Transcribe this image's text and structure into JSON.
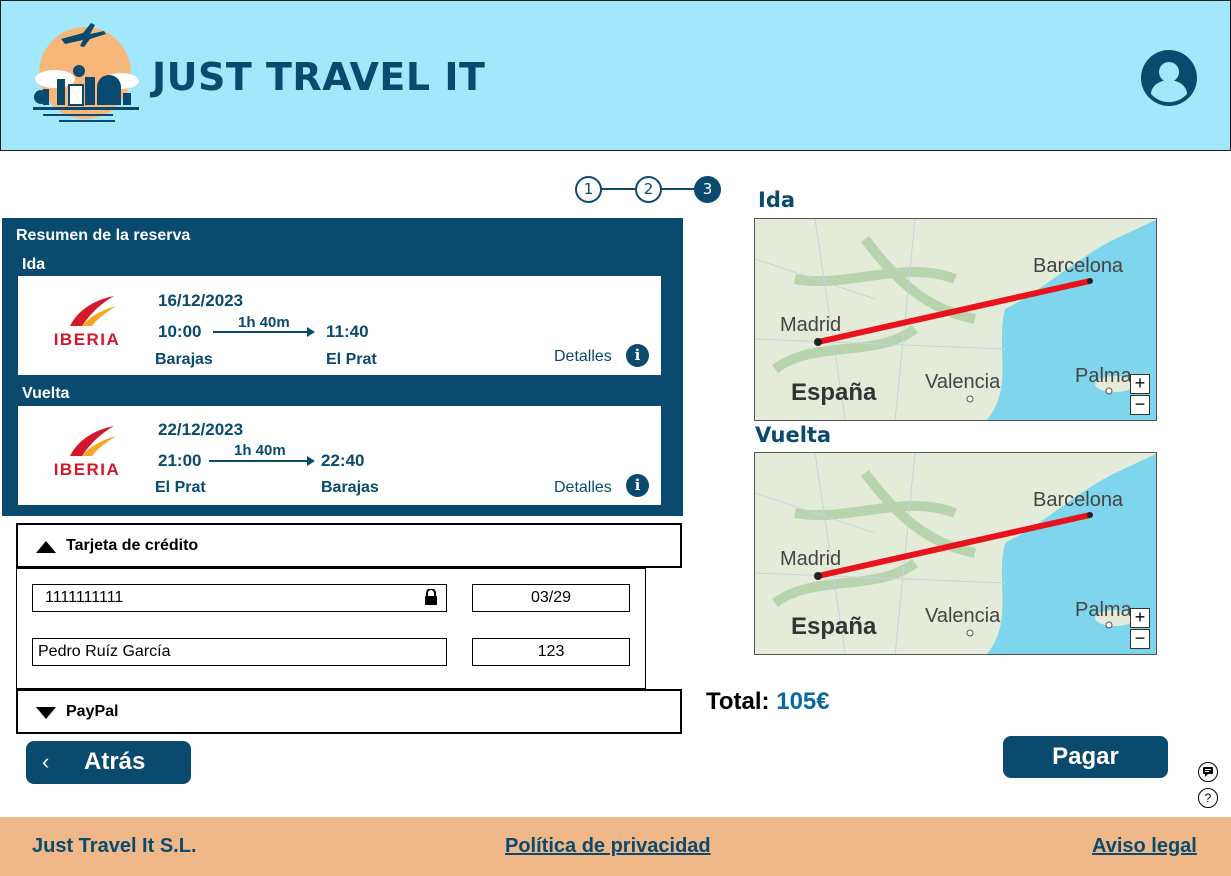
{
  "header": {
    "brand": "JUST TRAVEL IT",
    "logo_icon": "travel-logo-icon",
    "user_icon": "user-account-icon"
  },
  "stepper": {
    "steps": [
      "1",
      "2",
      "3"
    ],
    "current_step": 3
  },
  "summary": {
    "title": "Resumen de la reserva",
    "outbound": {
      "label": "Ida",
      "airline": "IBERIA",
      "date": "16/12/2023",
      "depart_time": "10:00",
      "duration": "1h 40m",
      "arrive_time": "11:40",
      "from": "Barajas",
      "to": "El Prat",
      "details": "Detalles"
    },
    "return": {
      "label": "Vuelta",
      "airline": "IBERIA",
      "date": "22/12/2023",
      "depart_time": "21:00",
      "duration": "1h 40m",
      "arrive_time": "22:40",
      "from": "El Prat",
      "to": "Barajas",
      "details": "Detalles"
    }
  },
  "payment": {
    "credit_card_label": "Tarjeta de crédito",
    "card_number": "1111111111",
    "expiry": "03/29",
    "holder": "Pedro Ruíz García",
    "cvv": "123",
    "paypal_label": "PayPal"
  },
  "maps": {
    "outbound_label": "Ida",
    "return_label": "Vuelta",
    "cities": {
      "madrid": "Madrid",
      "barcelona": "Barcelona",
      "valencia": "Valencia",
      "palma": "Palma",
      "espana": "España"
    },
    "zoom_in": "+",
    "zoom_out": "−",
    "colors": {
      "land": "#e4ecd9",
      "sea": "#7fd6ec",
      "route": "#e8131c"
    }
  },
  "total": {
    "label": "Total:",
    "amount": "105€"
  },
  "buttons": {
    "back": "Atrás",
    "pay": "Pagar"
  },
  "side_icons": {
    "feedback": "feedback-icon",
    "help": "?"
  },
  "footer": {
    "company": "Just Travel It S.L.",
    "privacy": "Política de privacidad",
    "legal": "Aviso legal"
  },
  "colors": {
    "primary": "#0a4a6e",
    "header_bg": "#a3e7fd",
    "footer_bg": "#f0b889",
    "airline_red": "#d4182c"
  }
}
